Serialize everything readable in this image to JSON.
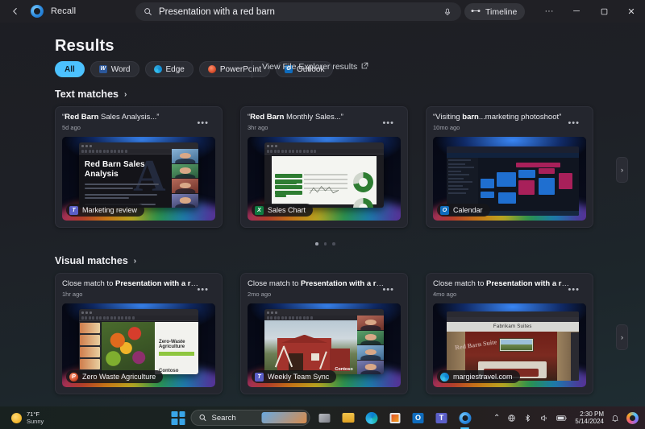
{
  "titlebar": {
    "back_icon": "back-arrow-icon",
    "app_logo_icon": "recall-logo-icon",
    "app_name": "Recall",
    "search": {
      "icon": "search-icon",
      "value": "Presentation with a red barn",
      "placeholder": "Search",
      "mic_icon": "microphone-icon"
    },
    "timeline": {
      "icon": "timeline-icon",
      "label": "Timeline"
    },
    "more_label": "···",
    "minimize_label": "─",
    "maximize_label": "❐",
    "close_label": "✕"
  },
  "page": {
    "title": "Results"
  },
  "filters": [
    {
      "label": "All",
      "icon": "",
      "active": true
    },
    {
      "label": "Word",
      "icon": "word-icon",
      "active": false
    },
    {
      "label": "Edge",
      "icon": "edge-icon",
      "active": false
    },
    {
      "label": "PowerPoint",
      "icon": "powerpoint-icon",
      "active": false
    },
    {
      "label": "Outlook",
      "icon": "outlook-icon",
      "active": false
    }
  ],
  "file_explorer_link": {
    "label": "View File Explorer results",
    "icon": "external-link-icon"
  },
  "sections": [
    {
      "heading": "Text matches",
      "chevron": "›",
      "cards": [
        {
          "title_bold": "Red Barn",
          "title_rest": " Sales Analysis...",
          "quoted": true,
          "time": "5d ago",
          "badge": "Marketing review",
          "badge_icon": "teams-icon",
          "menu": "•••"
        },
        {
          "title_bold": "Red Barn",
          "title_rest": " Monthly Sales...",
          "quoted": true,
          "time": "3hr ago",
          "badge": "Sales Chart",
          "badge_icon": "excel-icon",
          "menu": "•••"
        },
        {
          "title_bold": "barn",
          "title_rest": "...marketing photoshoot",
          "title_pre": "Visiting ",
          "quoted": true,
          "time": "10mo ago",
          "badge": "Calendar",
          "badge_icon": "outlook-icon",
          "menu": "•••"
        }
      ],
      "next_arrow": "›",
      "pager": {
        "count": 3,
        "active": 0
      }
    },
    {
      "heading": "Visual matches",
      "chevron": "›",
      "cards": [
        {
          "title_pre": "Close match to ",
          "title_bold": "Presentation with a red barn",
          "title_rest": "",
          "quoted": false,
          "time": "1hr ago",
          "badge": "Zero Waste Agriculture",
          "badge_icon": "powerpoint-icon",
          "menu": "•••"
        },
        {
          "title_pre": "Close match to ",
          "title_bold": "Presentation with a red barn",
          "title_rest": "",
          "quoted": false,
          "time": "2mo ago",
          "badge": "Weekly Team Sync",
          "badge_icon": "teams-icon",
          "menu": "•••"
        },
        {
          "title_pre": "Close match to ",
          "title_bold": "Presentation with a red barn",
          "title_rest": "",
          "quoted": false,
          "time": "4mo ago",
          "badge": "margiestravel.com",
          "badge_icon": "edge-icon",
          "menu": "•••"
        }
      ],
      "next_arrow": "›"
    }
  ],
  "thumbnails": {
    "slide1_heading": "Red Barn Sales\nAnalysis",
    "slide4_heading": "Zero-Waste Agriculture",
    "slide4_logo": "Contoso",
    "slide5_logo": "Contoso",
    "browser_site_title": "Fabrikam Suites",
    "browser_graffiti": "Red Barn Suite"
  },
  "taskbar": {
    "weather": {
      "temp": "71°F",
      "condition": "Sunny",
      "icon": "sun-icon"
    },
    "start_icon": "windows-start-icon",
    "search": {
      "icon": "search-icon",
      "placeholder": "Search"
    },
    "icons": [
      {
        "name": "task-view-icon"
      },
      {
        "name": "file-explorer-icon"
      },
      {
        "name": "edge-icon"
      },
      {
        "name": "microsoft-store-icon"
      },
      {
        "name": "outlook-icon"
      },
      {
        "name": "teams-icon"
      },
      {
        "name": "recall-icon"
      }
    ],
    "tray": {
      "chevron_up": "⌃",
      "network_icon": "network-icon",
      "bluetooth_icon": "bluetooth-icon",
      "volume_icon": "volume-icon",
      "battery_icon": "battery-icon",
      "time": "2:30 PM",
      "date": "5/14/2024",
      "bell_icon": "notification-bell-icon",
      "copilot_icon": "copilot-icon"
    }
  },
  "colors": {
    "accent": "#4cc2ff",
    "card_bg": "#24262e",
    "window_bg": "#1d1e23"
  }
}
